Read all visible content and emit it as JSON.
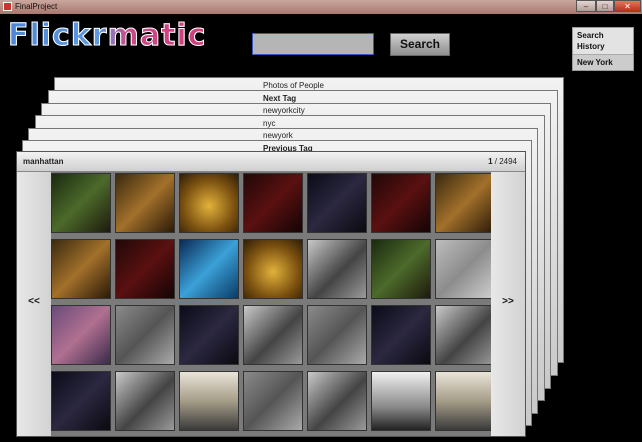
{
  "window": {
    "title": "FinalProject",
    "controls": {
      "min": "–",
      "max": "□",
      "close": "✕"
    }
  },
  "logo": {
    "text": "Flickrmatic"
  },
  "search": {
    "value": "",
    "placeholder": "",
    "button_label": "Search"
  },
  "history": {
    "title": "Search History",
    "items": [
      "New York"
    ]
  },
  "stack": {
    "cards": [
      {
        "label": "Photos of People",
        "bold": false
      },
      {
        "label": "Next Tag",
        "bold": true
      },
      {
        "label": "newyorkcity",
        "bold": false
      },
      {
        "label": "nyc",
        "bold": false
      },
      {
        "label": "newyork",
        "bold": false
      },
      {
        "label": "Previous Tag",
        "bold": true
      }
    ]
  },
  "front": {
    "title": "manhattan",
    "page_current": "1",
    "page_total": " / 2494",
    "prev_label": "<<",
    "next_label": ">>"
  },
  "thumbnails": {
    "rows": [
      [
        "t-green",
        "t-warm",
        "t-gold",
        "t-red",
        "t-night",
        "t-red",
        "t-warm"
      ],
      [
        "t-warm",
        "t-red",
        "t-blue",
        "t-gold",
        "t-street",
        "t-green",
        "t-mist"
      ],
      [
        "t-rain",
        "t-grey",
        "t-night",
        "t-street",
        "t-grey",
        "t-night",
        "t-street"
      ],
      [
        "t-night",
        "t-street",
        "t-sky",
        "t-grey",
        "t-street",
        "t-tower",
        "t-sky"
      ]
    ]
  }
}
